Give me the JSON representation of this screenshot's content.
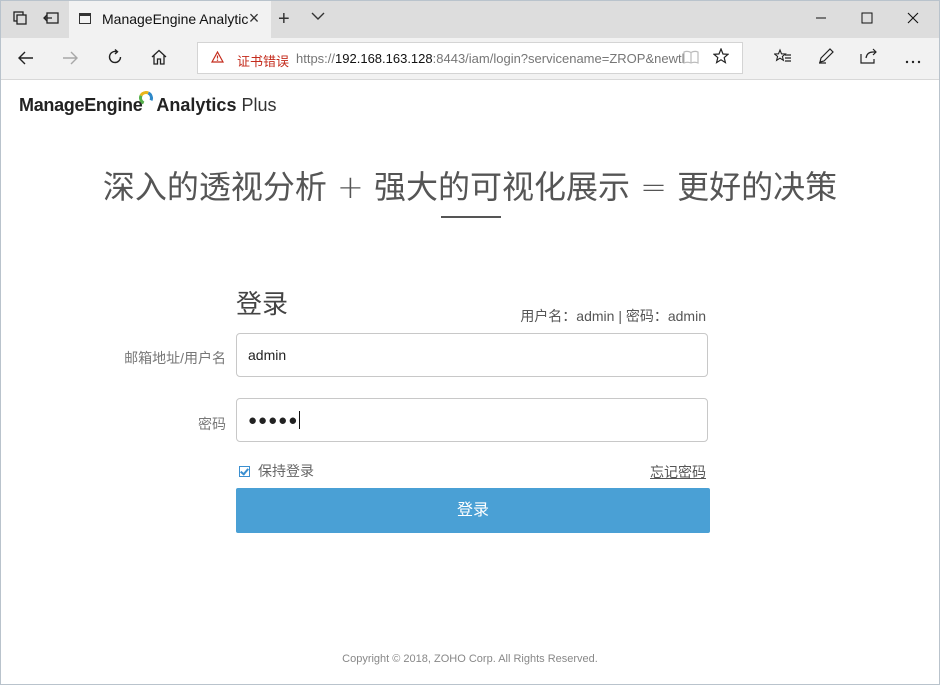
{
  "browser": {
    "tab_title": "ManageEngine Analytic",
    "new_tab_label": "+",
    "cert_error": "证书错误",
    "url_proto": "https://",
    "url_host": "192.168.163.128",
    "url_path": ":8443/iam/login?servicename=ZROP&newtl"
  },
  "icons": {
    "tab_actions": "window-tabs-icon",
    "set_aside": "set-aside-tabs-icon",
    "back": "arrow-left-icon",
    "forward": "arrow-right-icon",
    "refresh": "refresh-icon",
    "home": "home-icon",
    "warning": "warning-triangle-icon",
    "reading": "reading-view-icon",
    "favorite": "star-icon",
    "favorites_hub": "favorites-hub-icon",
    "notes": "pen-icon",
    "share": "share-icon",
    "more": "more-icon"
  },
  "page": {
    "logo_brand": "ManageEngine",
    "logo_product": "Analytics",
    "logo_suffix": "Plus",
    "hero": "深入的透视分析 + 强大的可视化展示 = 更好的决策",
    "login_title": "登录",
    "hint": "用户名：admin | 密码：admin",
    "email_label": "邮箱地址/用户名",
    "email_value": "admin",
    "password_label": "密码",
    "password_masked": "●●●●●",
    "remember_label": "保持登录",
    "forgot_label": "忘记密码",
    "submit_label": "登录",
    "footer": "Copyright © 2018, ZOHO Corp. All Rights Reserved."
  },
  "colors": {
    "accent": "#4aa0d5",
    "cert_error": "#c42b1c"
  }
}
